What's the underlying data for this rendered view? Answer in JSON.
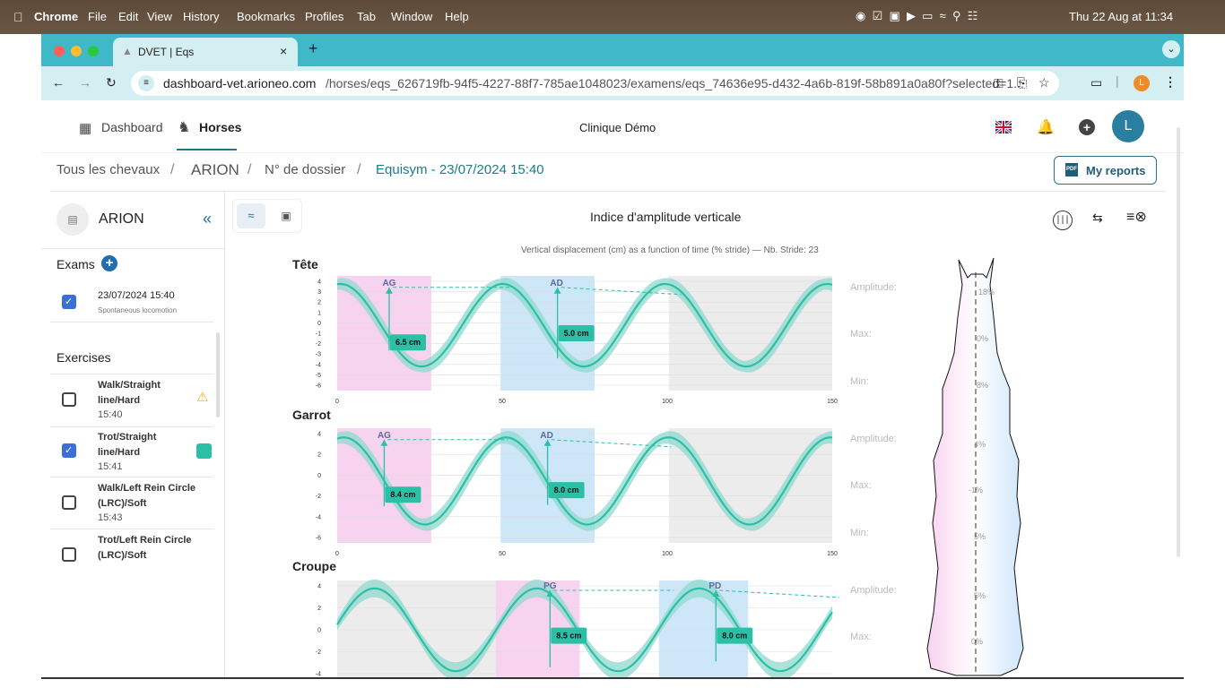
{
  "mac_menu": {
    "apple": "",
    "app": "Chrome",
    "items": [
      "File",
      "Edit",
      "View",
      "History",
      "Bookmarks",
      "Profiles",
      "Tab",
      "Window",
      "Help"
    ],
    "clock": "Thu 22 Aug at 11:34"
  },
  "browser": {
    "tab_title": "DVET | Eqs",
    "new_tab": "+",
    "url_domain": "dashboard-vet.arioneo.com",
    "url_path": "/horses/eqs_626719fb-94f5-4227-88f7-785ae1048023/examens/eqs_74636e95-d432-4a6b-819f-58b891a0a80f?selected=1...",
    "profile_initial": "L"
  },
  "topnav": {
    "dashboard": "Dashboard",
    "horses": "Horses",
    "clinic": "Clinique Démo",
    "avatar": "L"
  },
  "breadcrumb": {
    "all": "Tous les chevaux",
    "sep": "/",
    "horse": "ARION",
    "file": "N° de dossier",
    "exam": "Equisym - 23/07/2024 15:40"
  },
  "reports_btn": "My reports",
  "sidebar": {
    "horse_name": "ARION",
    "collapse": "«",
    "exams_title": "Exams",
    "exam": {
      "date": "23/07/2024 15:40",
      "type": "Spontaneous locomotion"
    },
    "exercises_title": "Exercises",
    "exercises": [
      {
        "name": "Walk/Straight line/Hard",
        "time": "15:40",
        "checked": false,
        "badge": "warning"
      },
      {
        "name": "Trot/Straight line/Hard",
        "time": "15:41",
        "checked": true,
        "badge": "teal"
      },
      {
        "name": "Walk/Left Rein Circle (LRC)/Soft",
        "time": "15:43",
        "checked": false,
        "badge": ""
      },
      {
        "name": "Trot/Left Rein Circle (LRC)/Soft",
        "time": "",
        "checked": false,
        "badge": ""
      }
    ]
  },
  "main": {
    "title": "Indice d'amplitude verticale",
    "subtitle": "Vertical displacement (cm) as a function of time (% stride) — Nb. Stride: 23",
    "side_labels": {
      "amplitude": "Amplitude:",
      "max": "Max:",
      "min": "Min:"
    },
    "horse_pcts": [
      "18%",
      "0%",
      "8%",
      "4%",
      "-1%",
      "5%",
      "5%",
      "0%"
    ]
  },
  "colors": {
    "teal": "#2bbfa6",
    "band": "#8fd9cf",
    "pink": "#f8d3ef",
    "blue": "#cde6f8",
    "grey": "#ececec"
  },
  "chart_data": [
    {
      "type": "line",
      "title": "Tête",
      "y_ticks": [
        "4",
        "3",
        "2",
        "1",
        "0",
        "-1",
        "-2",
        "-3",
        "-4",
        "-5",
        "-6"
      ],
      "x_ticks": [
        "0",
        "50",
        "100",
        "150"
      ],
      "xlim": [
        0,
        150
      ],
      "ylim": [
        -6,
        4
      ],
      "markers": [
        {
          "label": "AG",
          "value": "6.5 cm"
        },
        {
          "label": "AD",
          "value": "5.0 cm"
        }
      ]
    },
    {
      "type": "line",
      "title": "Garrot",
      "y_ticks": [
        "4",
        "2",
        "0",
        "-2",
        "-4",
        "-6"
      ],
      "x_ticks": [
        "0",
        "50",
        "100",
        "150"
      ],
      "xlim": [
        0,
        150
      ],
      "ylim": [
        -6,
        5
      ],
      "markers": [
        {
          "label": "AG",
          "value": "8.4 cm"
        },
        {
          "label": "AD",
          "value": "8.0 cm"
        }
      ]
    },
    {
      "type": "line",
      "title": "Croupe",
      "y_ticks": [
        "4",
        "2",
        "0",
        "-2",
        "-4"
      ],
      "x_ticks": [],
      "xlim": [
        0,
        150
      ],
      "ylim": [
        -5,
        5
      ],
      "markers": [
        {
          "label": "PG",
          "value": "8.5 cm"
        },
        {
          "label": "PD",
          "value": "8.0 cm"
        }
      ]
    }
  ]
}
